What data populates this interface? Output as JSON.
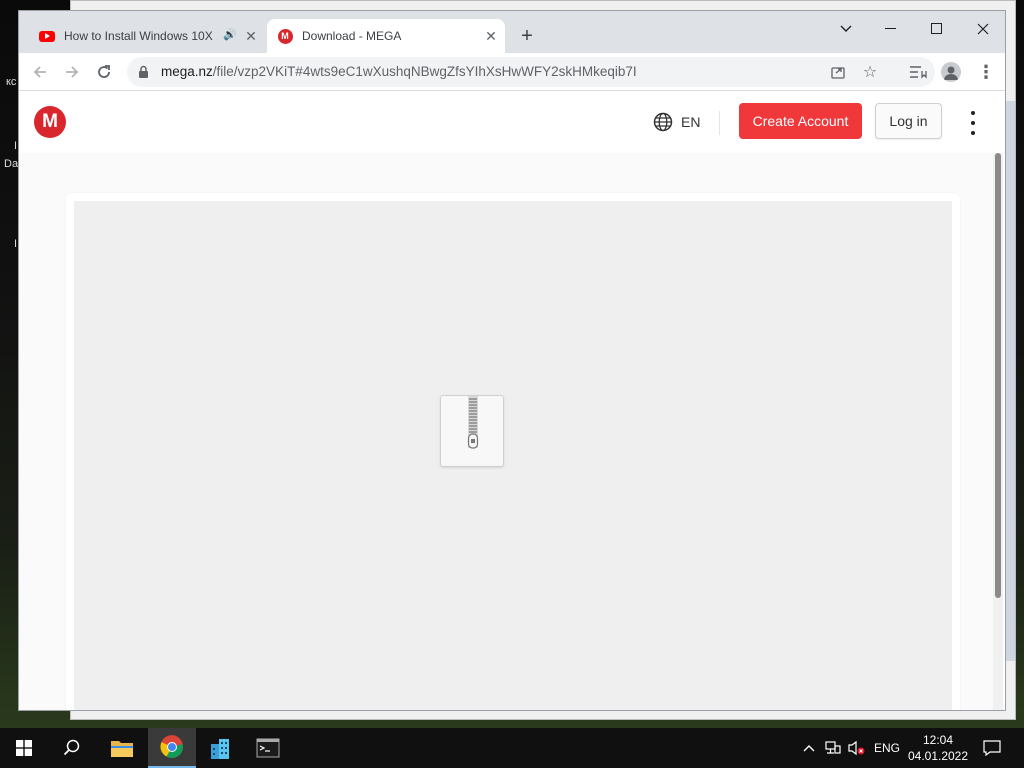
{
  "desktop": {
    "fragments": [
      "кс",
      "I",
      "Da",
      "I"
    ]
  },
  "browser": {
    "tabs": [
      {
        "title": "How to Install Windows 10X",
        "favicon": "youtube-icon",
        "audio": "speaker-icon"
      },
      {
        "title": "Download - MEGA",
        "favicon": "mega-icon"
      }
    ],
    "new_tab_label": "+",
    "url": {
      "host": "mega.nz",
      "path": "/file/vzp2VKiT#4wts9eC1wXushqNBwgZfsYIhXsHwWFY2skHMkeqib7I"
    }
  },
  "site": {
    "logo_letter": "M",
    "language": "EN",
    "create_account": "Create Account",
    "login": "Log in",
    "accent_color": "#f0373a",
    "preview_icon": "zip-file-icon"
  },
  "taskbar": {
    "language": "ENG",
    "time": "12:04",
    "date": "04.01.2022"
  }
}
